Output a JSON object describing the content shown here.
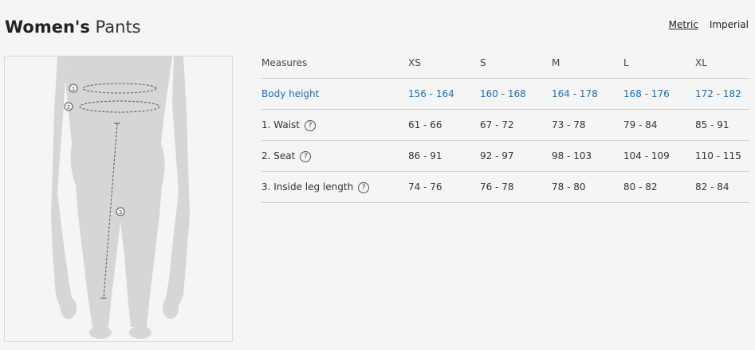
{
  "title": {
    "bold": "Women's",
    "light": "Pants"
  },
  "units": {
    "metric": "Metric",
    "imperial": "Imperial"
  },
  "figure": {
    "markers": [
      "1",
      "2",
      "3"
    ]
  },
  "table": {
    "headers": [
      "Measures",
      "XS",
      "S",
      "M",
      "L",
      "XL"
    ],
    "rows": [
      {
        "label": "Body height",
        "values": [
          "156 - 164",
          "160 - 168",
          "164 - 178",
          "168 - 176",
          "172 - 182"
        ]
      },
      {
        "label": "1. Waist",
        "values": [
          "61 - 66",
          "67 - 72",
          "73 - 78",
          "79 - 84",
          "85 - 91"
        ]
      },
      {
        "label": "2. Seat",
        "values": [
          "86 - 91",
          "92 - 97",
          "98 - 103",
          "104 - 109",
          "110 - 115"
        ]
      },
      {
        "label": "3. Inside leg length",
        "values": [
          "74 - 76",
          "76 - 78",
          "78 - 80",
          "80 - 82",
          "82 - 84"
        ]
      }
    ],
    "help_symbol": "?"
  },
  "colors": {
    "accent": "#1a6fbd",
    "silhouette": "#d6d6d6"
  }
}
